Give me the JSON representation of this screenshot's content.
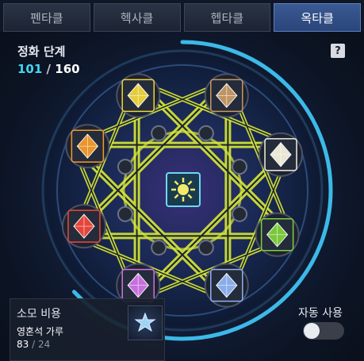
{
  "tabs": [
    {
      "label": "펜타클",
      "active": false
    },
    {
      "label": "헥사클",
      "active": false
    },
    {
      "label": "헵타클",
      "active": false
    },
    {
      "label": "옥타클",
      "active": true
    }
  ],
  "purification": {
    "label": "정화 단계",
    "current": "101",
    "separator": "/",
    "max": "160",
    "progress_fraction": 0.63
  },
  "help": {
    "glyph": "?"
  },
  "gems": [
    {
      "name": "yellow",
      "color": "#f0d63a"
    },
    {
      "name": "bronze",
      "color": "#c89a66"
    },
    {
      "name": "white",
      "color": "#f4f1de"
    },
    {
      "name": "green",
      "color": "#7fd13a"
    },
    {
      "name": "blue",
      "color": "#8fb3f5"
    },
    {
      "name": "purple",
      "color": "#cf73e6"
    },
    {
      "name": "red",
      "color": "#f0473a"
    },
    {
      "name": "orange",
      "color": "#f59a2a"
    }
  ],
  "center_emblem": {
    "icon": "sun-icon",
    "color": "#f2e96a"
  },
  "cost": {
    "label": "소모 비용",
    "item_name": "영혼석 가루",
    "have": "83",
    "separator": "/",
    "need": "24",
    "icon": "soul-stone-icon"
  },
  "auto_use": {
    "label": "자동 사용",
    "enabled": false
  },
  "colors": {
    "accent": "#42d6f5",
    "star_line": "#d6e83a",
    "ring": "#3cb9e8"
  }
}
